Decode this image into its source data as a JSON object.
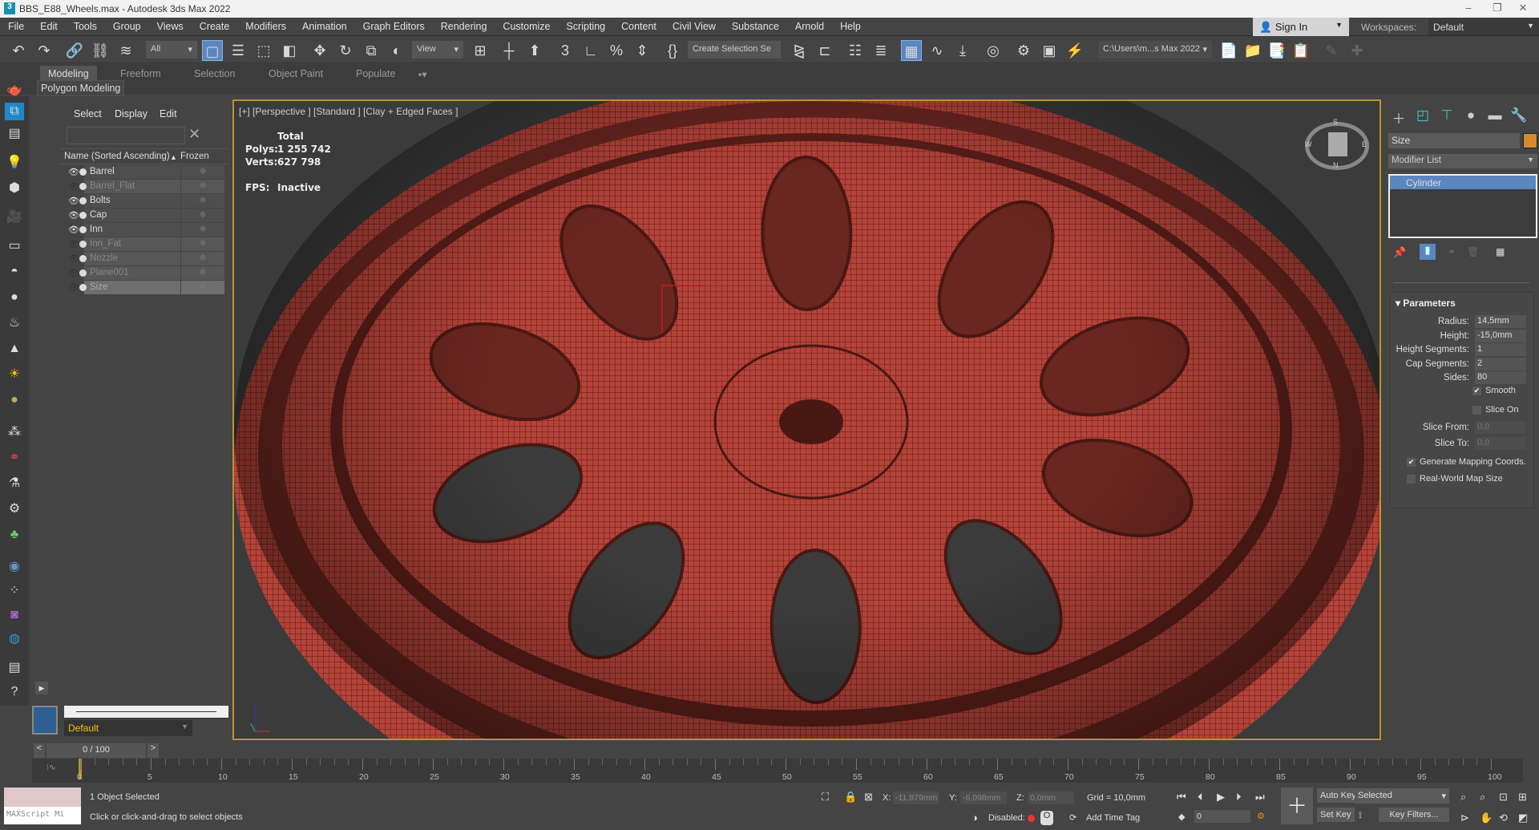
{
  "window": {
    "title": "BBS_E88_Wheels.max - Autodesk 3ds Max 2022",
    "app_icon": "3"
  },
  "menu": [
    "File",
    "Edit",
    "Tools",
    "Group",
    "Views",
    "Create",
    "Modifiers",
    "Animation",
    "Graph Editors",
    "Rendering",
    "Customize",
    "Scripting",
    "Content",
    "Civil View",
    "Substance",
    "Arnold",
    "Help"
  ],
  "account": {
    "sign_in": "Sign In",
    "workspaces_label": "Workspaces:",
    "workspace": "Default"
  },
  "toolbar": {
    "filter": "All",
    "ref_coord": "View",
    "selection_set": "Create Selection Se",
    "project_path": "C:\\Users\\m...s Max 2022"
  },
  "ribbon": {
    "tabs": [
      "Modeling",
      "Freeform",
      "Selection",
      "Object Paint",
      "Populate"
    ],
    "active": "Modeling",
    "panel": "Polygon Modeling"
  },
  "explorer": {
    "tabs": [
      "Select",
      "Display",
      "Edit"
    ],
    "col_name": "Name (Sorted Ascending)",
    "sort_arrow": "▲",
    "col_frozen": "Frozen",
    "rows": [
      {
        "name": "Barrel",
        "visible": true
      },
      {
        "name": "Barrel_Flat",
        "visible": false
      },
      {
        "name": "Bolts",
        "visible": true
      },
      {
        "name": "Cap",
        "visible": true
      },
      {
        "name": "Inn",
        "visible": true
      },
      {
        "name": "Inn_Fat",
        "visible": false
      },
      {
        "name": "Nozzle",
        "visible": false
      },
      {
        "name": "Plane001",
        "visible": false
      },
      {
        "name": "Size",
        "visible": false,
        "selected": true
      }
    ],
    "layer": "Default"
  },
  "viewport": {
    "label": "[+] [Perspective ] [Standard ] [Clay + Edged Faces ]",
    "stats_header": "Total",
    "polys_label": "Polys:",
    "polys": "1 255 742",
    "verts_label": "Verts:",
    "verts": "627 798",
    "fps_label": "FPS:",
    "fps": "Inactive",
    "viewcube": {
      "s": "S",
      "w": "W",
      "e": "E",
      "n": "N"
    },
    "mesh_color": "#b5433a"
  },
  "command_panel": {
    "object_name": "Size",
    "object_color": "#d48a2f",
    "modifier_list": "Modifier List",
    "stack": [
      "Cylinder"
    ],
    "rollout": "Parameters",
    "params": [
      {
        "label": "Radius:",
        "value": "14,5mm"
      },
      {
        "label": "Height:",
        "value": "-15,0mm"
      },
      {
        "label": "Height Segments:",
        "value": "1"
      },
      {
        "label": "Cap Segments:",
        "value": "2"
      },
      {
        "label": "Sides:",
        "value": "80"
      }
    ],
    "smooth": {
      "label": "Smooth",
      "checked": true
    },
    "slice_on": {
      "label": "Slice On",
      "checked": false
    },
    "slice_from": {
      "label": "Slice From:",
      "value": "0,0"
    },
    "slice_to": {
      "label": "Slice To:",
      "value": "0,0"
    },
    "gen_mapping": {
      "label": "Generate Mapping Coords.",
      "checked": true
    },
    "real_world": {
      "label": "Real-World Map Size",
      "checked": false
    }
  },
  "timeline": {
    "frame": "0 / 100",
    "ticks": [
      "0",
      "5",
      "10",
      "15",
      "20",
      "25",
      "30",
      "35",
      "40",
      "45",
      "50",
      "55",
      "60",
      "65",
      "70",
      "75",
      "80",
      "85",
      "90",
      "95",
      "100"
    ]
  },
  "status": {
    "maxscript": "MAXScript Mi",
    "selected": "1 Object Selected",
    "prompt": "Click or click-and-drag to select objects",
    "x_label": "X:",
    "x": "-11,879mm",
    "y_label": "Y:",
    "y": "-6,098mm",
    "z_label": "Z:",
    "z": "0,0mm",
    "grid": "Grid = 10,0mm",
    "disabled": "Disabled:",
    "add_time_tag": "Add Time Tag",
    "auto_key": "Auto Key",
    "set_key": "Set Key",
    "key_mode": "Selected",
    "key_filters": "Key Filters...",
    "current_frame": "0"
  }
}
